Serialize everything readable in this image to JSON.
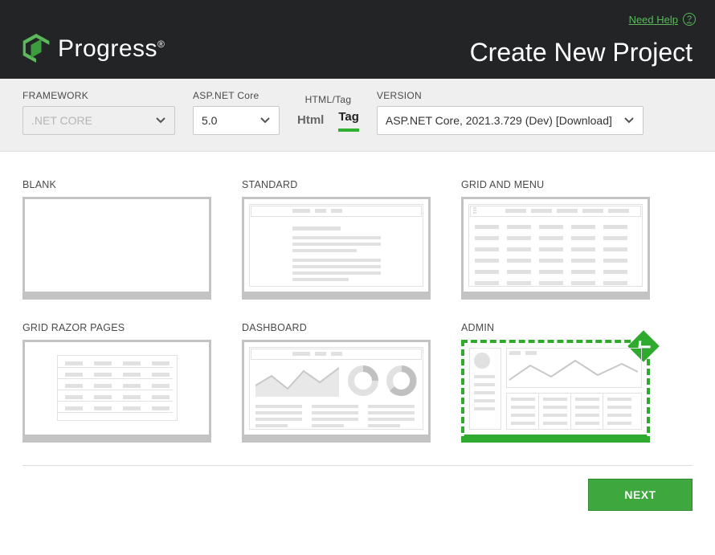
{
  "header": {
    "help_label": "Need Help",
    "brand_name": "Progress",
    "title": "Create New Project"
  },
  "config": {
    "framework": {
      "label": "FRAMEWORK",
      "value": ".NET CORE"
    },
    "aspnet": {
      "label": "ASP.NET Core",
      "value": "5.0"
    },
    "htmltag": {
      "label": "HTML/Tag",
      "tabs": [
        "Html",
        "Tag"
      ],
      "active": "Tag"
    },
    "version": {
      "label": "VERSION",
      "value": "ASP.NET Core, 2021.3.729 (Dev) [Download]"
    }
  },
  "templates": [
    {
      "id": "blank",
      "name": "BLANK",
      "selected": false
    },
    {
      "id": "standard",
      "name": "STANDARD",
      "selected": false
    },
    {
      "id": "gridmenu",
      "name": "GRID AND MENU",
      "selected": false
    },
    {
      "id": "gridrazor",
      "name": "GRID RAZOR PAGES",
      "selected": false
    },
    {
      "id": "dashboard",
      "name": "DASHBOARD",
      "selected": false
    },
    {
      "id": "admin",
      "name": "ADMIN",
      "selected": true
    }
  ],
  "footer": {
    "next_label": "NEXT"
  }
}
